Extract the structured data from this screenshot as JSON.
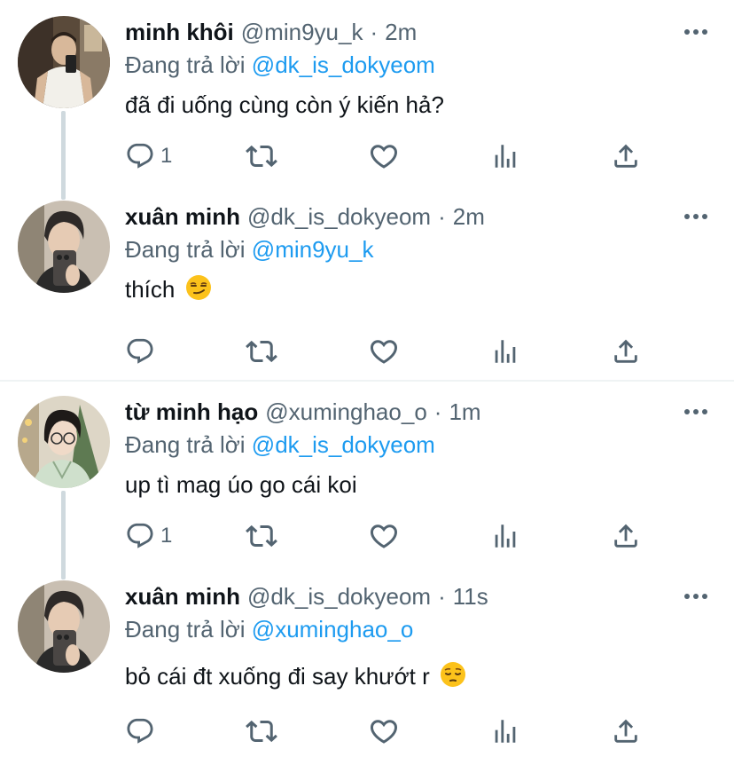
{
  "tweets": [
    {
      "name": "minh khôi",
      "handle": "@min9yu_k",
      "time": "2m",
      "replying_prefix": "Đang trả lời",
      "replying_to": "@dk_is_dokyeom",
      "text": "đã đi uống cùng còn ý kiến hả?",
      "reply_count": "1"
    },
    {
      "name": "xuân minh",
      "handle": "@dk_is_dokyeom",
      "time": "2m",
      "replying_prefix": "Đang trả lời",
      "replying_to": "@min9yu_k",
      "text": "thích",
      "emoji": "smirk",
      "reply_count": ""
    },
    {
      "name": "từ minh hạo",
      "handle": "@xuminghao_o",
      "time": "1m",
      "replying_prefix": "Đang trả lời",
      "replying_to": "@dk_is_dokyeom",
      "text": "up tì mag úo go cái koi",
      "reply_count": "1"
    },
    {
      "name": "xuân minh",
      "handle": "@dk_is_dokyeom",
      "time": "11s",
      "replying_prefix": "Đang trả lời",
      "replying_to": "@xuminghao_o",
      "text": "bỏ cái đt xuống đi say khướt r",
      "emoji": "pensive",
      "reply_count": ""
    }
  ],
  "separator": "·",
  "colors": {
    "text": "#0f1419",
    "muted": "#536471",
    "link": "#1d9bf0",
    "divider": "#eff3f4",
    "thread_line": "#cfd9de"
  },
  "icons": [
    "reply-icon",
    "retweet-icon",
    "like-icon",
    "views-icon",
    "share-icon",
    "more-icon"
  ]
}
